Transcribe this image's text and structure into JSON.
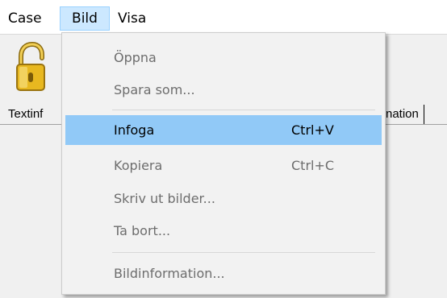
{
  "menubar": {
    "items": [
      "Case",
      "Bild",
      "Visa"
    ]
  },
  "tabs": {
    "left_label": "Textinf",
    "right_label": "nation"
  },
  "menu": {
    "items": [
      {
        "label": "Öppna",
        "shortcut": "",
        "enabled": false
      },
      {
        "label": "Spara som...",
        "shortcut": "",
        "enabled": false
      },
      {
        "label": "Infoga",
        "shortcut": "Ctrl+V",
        "enabled": true,
        "highlighted": true
      },
      {
        "label": "Kopiera",
        "shortcut": "Ctrl+C",
        "enabled": false
      },
      {
        "label": "Skriv ut bilder...",
        "shortcut": "",
        "enabled": false
      },
      {
        "label": "Ta bort...",
        "shortcut": "",
        "enabled": false
      },
      {
        "label": "Bildinformation...",
        "shortcut": "",
        "enabled": false
      }
    ]
  },
  "colors": {
    "highlight": "#91c9f7",
    "menubar_active": "#cce8ff",
    "lock_gold": "#e8b820"
  },
  "icons": {
    "toolbar_lock": "unlocked-padlock-icon"
  }
}
